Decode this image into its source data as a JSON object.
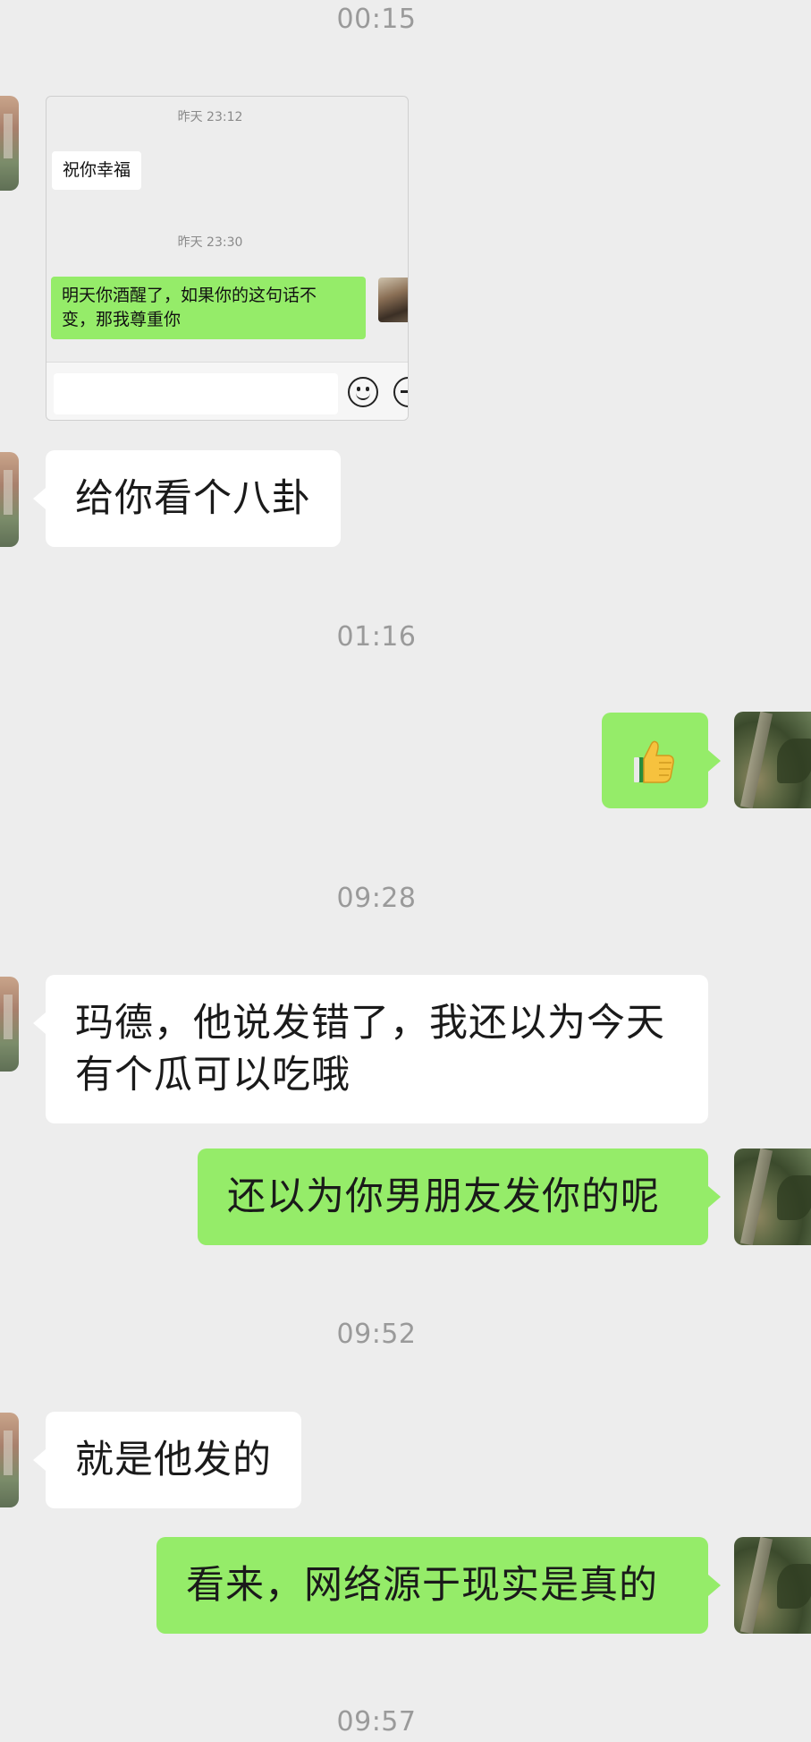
{
  "colors": {
    "background": "#ededed",
    "bubble_sent": "#95ec69",
    "bubble_received": "#ffffff",
    "timestamp": "#9a9a9a"
  },
  "timestamps": [
    "00:15",
    "01:16",
    "09:28",
    "09:52",
    "09:57"
  ],
  "forwarded_card": {
    "timestamp_1": "昨天 23:12",
    "received_message": "祝你幸福",
    "timestamp_2": "昨天 23:30",
    "sent_message_line1": "明天你酒醒了，如果你的这句话不",
    "sent_message_line2": "变，那我尊重你",
    "input_icons": [
      "smile-icon",
      "plus-icon"
    ]
  },
  "messages": [
    {
      "side": "left",
      "text": "给你看个八卦"
    },
    {
      "side": "right",
      "type": "emoji",
      "emoji": "thumbs-up-icon"
    },
    {
      "side": "left",
      "line1": "玛德，他说发错了，我还以为今天",
      "line2": "有个瓜可以吃哦"
    },
    {
      "side": "right",
      "text": "还以为你男朋友发你的呢"
    },
    {
      "side": "left",
      "text": "就是他发的"
    },
    {
      "side": "right",
      "text": "看来，网络源于现实是真的"
    }
  ]
}
